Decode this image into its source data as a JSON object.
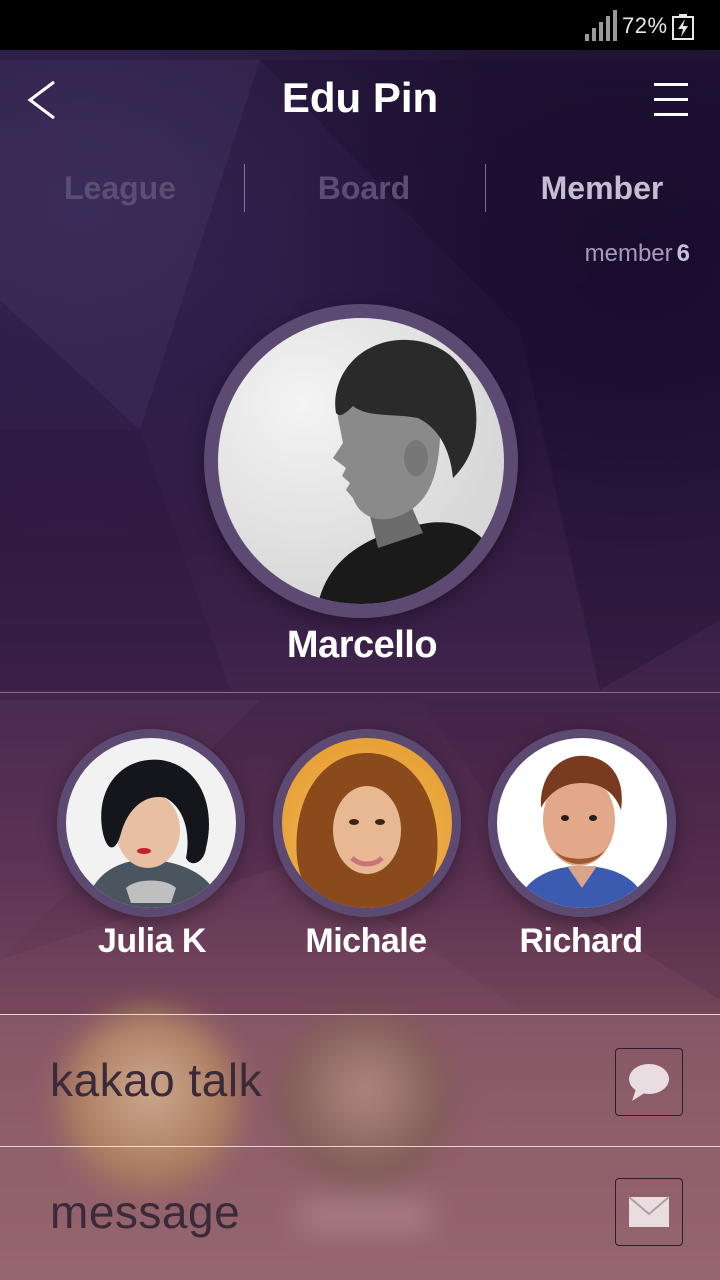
{
  "status_bar": {
    "battery_percent": "72%",
    "icons": [
      "signal-icon",
      "battery-charging-icon"
    ]
  },
  "header": {
    "title": "Edu Pin",
    "back_icon": "chevron-left-icon",
    "menu_icon": "hamburger-menu-icon"
  },
  "tabs": [
    {
      "label": "League",
      "active": false
    },
    {
      "label": "Board",
      "active": false
    },
    {
      "label": "Member",
      "active": true
    }
  ],
  "member_count": {
    "label": "member",
    "value": "6"
  },
  "leader": {
    "name": "Marcello"
  },
  "members": [
    {
      "name": "Julia K"
    },
    {
      "name": "Michale"
    },
    {
      "name": "Richard"
    }
  ],
  "share_sheet": {
    "options": [
      {
        "label": "kakao talk",
        "icon": "chat-bubble-icon"
      },
      {
        "label": "message",
        "icon": "envelope-icon"
      }
    ]
  },
  "colors": {
    "accent_tab_active": "#c6bcd4",
    "accent_tab_inactive": "#5c4e72",
    "avatar_ring": "#5d4a73",
    "title_text": "#ffffff"
  }
}
